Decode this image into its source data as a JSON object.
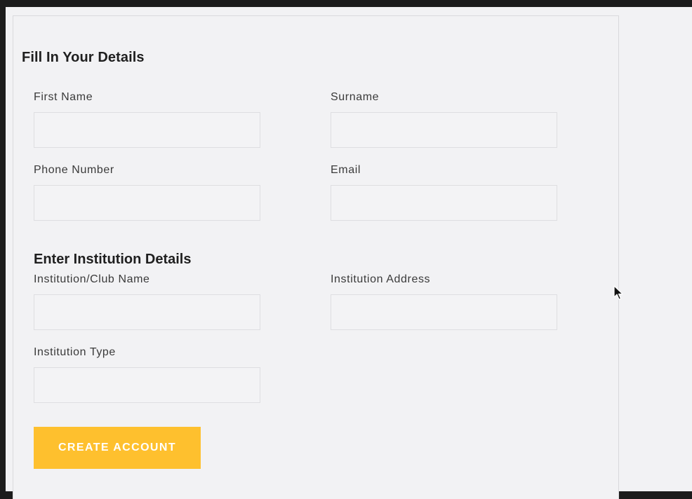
{
  "form": {
    "title": "Fill In Your Details",
    "section_title": "Enter Institution Details",
    "fields": {
      "first_name": {
        "label": "First Name",
        "value": "",
        "placeholder": ""
      },
      "surname": {
        "label": "Surname",
        "value": "",
        "placeholder": ""
      },
      "phone": {
        "label": "Phone Number",
        "value": "",
        "placeholder": ""
      },
      "email": {
        "label": "Email",
        "value": "",
        "placeholder": ""
      },
      "institution_name": {
        "label": "Institution/Club Name",
        "value": "",
        "placeholder": ""
      },
      "institution_address": {
        "label": "Institution Address",
        "value": "",
        "placeholder": ""
      },
      "institution_type": {
        "label": "Institution Type",
        "value": "",
        "placeholder": ""
      }
    },
    "submit_label": "CREATE ACCOUNT"
  },
  "colors": {
    "background": "#f2f2f4",
    "frame": "#1c1c1c",
    "button": "#fec02e",
    "button_text": "#ffffff"
  },
  "icons": {
    "cursor": "mouse-pointer-icon"
  }
}
